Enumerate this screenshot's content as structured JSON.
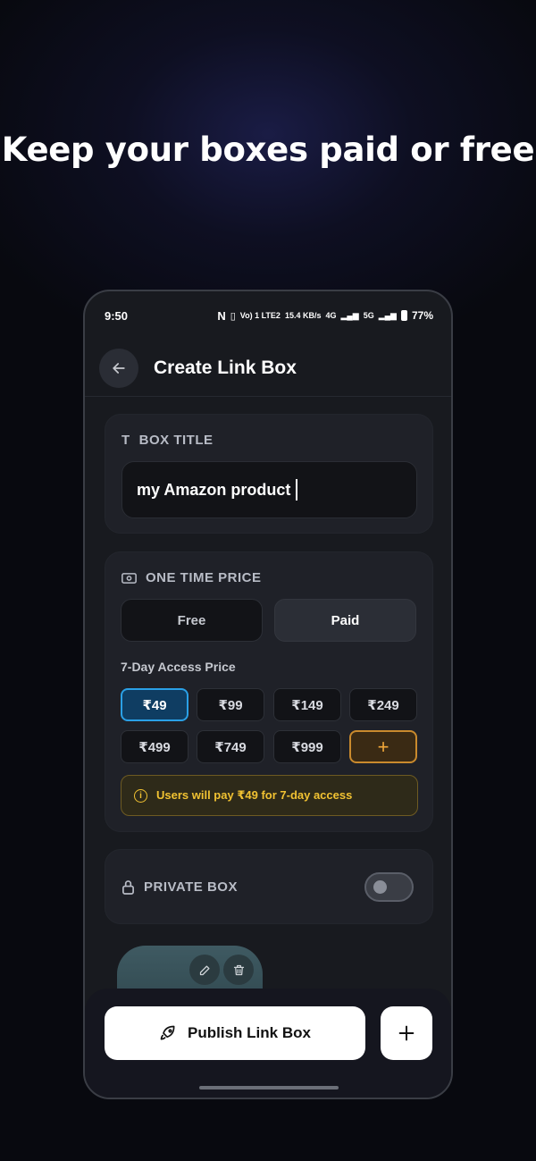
{
  "headline": "Keep your boxes paid or free",
  "status_bar": {
    "time": "9:50",
    "network_text": "Vo) 1 LTE2",
    "speed": "15.4 KB/s",
    "net4g": "4G",
    "net5g": "5G",
    "battery": "77%"
  },
  "appbar": {
    "title": "Create Link Box"
  },
  "box_title": {
    "label": "BOX TITLE",
    "value": "my Amazon product"
  },
  "price": {
    "label": "ONE TIME PRICE",
    "options": [
      "Free",
      "Paid"
    ],
    "selected_option": "Paid",
    "access_label": "7-Day Access Price",
    "chips": [
      "₹49",
      "₹99",
      "₹149",
      "₹249",
      "₹499",
      "₹749",
      "₹999"
    ],
    "selected_chip": "₹49",
    "add_chip": "+",
    "info": "Users will pay ₹49 for 7-day access"
  },
  "private_box": {
    "label": "PRIVATE BOX",
    "enabled": false
  },
  "bottom": {
    "publish_label": "Publish Link Box"
  },
  "colors": {
    "accent_blue": "#2aa0e6",
    "accent_orange": "#c98a2d",
    "warning_yellow": "#f1c232"
  }
}
